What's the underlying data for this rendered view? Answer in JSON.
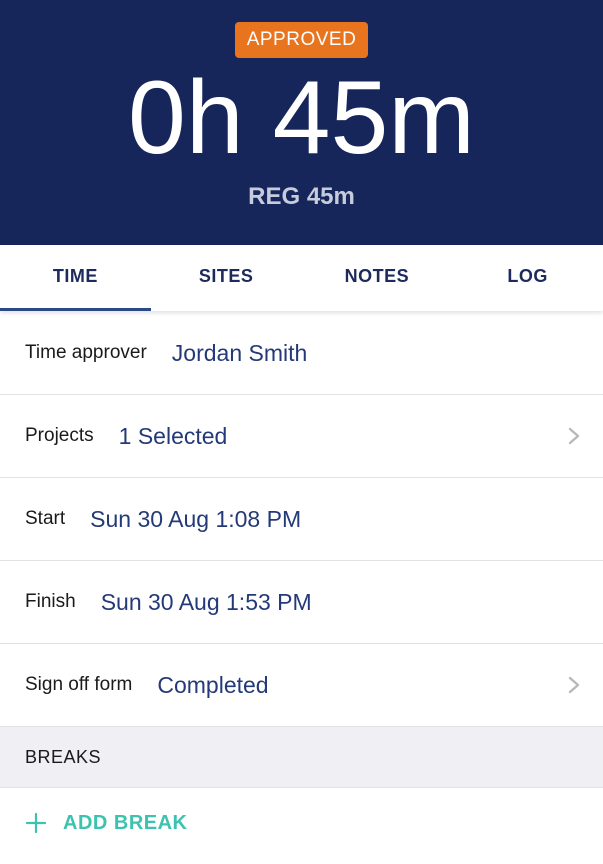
{
  "header": {
    "status_badge": "APPROVED",
    "total_duration": "0h 45m",
    "breakdown": "REG 45m"
  },
  "tabs": [
    {
      "label": "TIME",
      "active": true
    },
    {
      "label": "SITES",
      "active": false
    },
    {
      "label": "NOTES",
      "active": false
    },
    {
      "label": "LOG",
      "active": false
    }
  ],
  "details": {
    "time_approver": {
      "label": "Time approver",
      "value": "Jordan Smith"
    },
    "projects": {
      "label": "Projects",
      "value": "1 Selected",
      "icon": "chevron-right-icon"
    },
    "start": {
      "label": "Start",
      "value": "Sun 30 Aug 1:08 PM"
    },
    "finish": {
      "label": "Finish",
      "value": "Sun 30 Aug 1:53 PM"
    },
    "sign_off_form": {
      "label": "Sign off form",
      "value": "Completed",
      "icon": "chevron-right-icon"
    }
  },
  "breaks": {
    "section_title": "BREAKS",
    "add_label": "ADD BREAK",
    "add_icon": "plus-icon"
  },
  "colors": {
    "header_bg": "#17265a",
    "badge_bg": "#e8741e",
    "value_text": "#243a78",
    "accent_teal": "#3cc3b0"
  }
}
